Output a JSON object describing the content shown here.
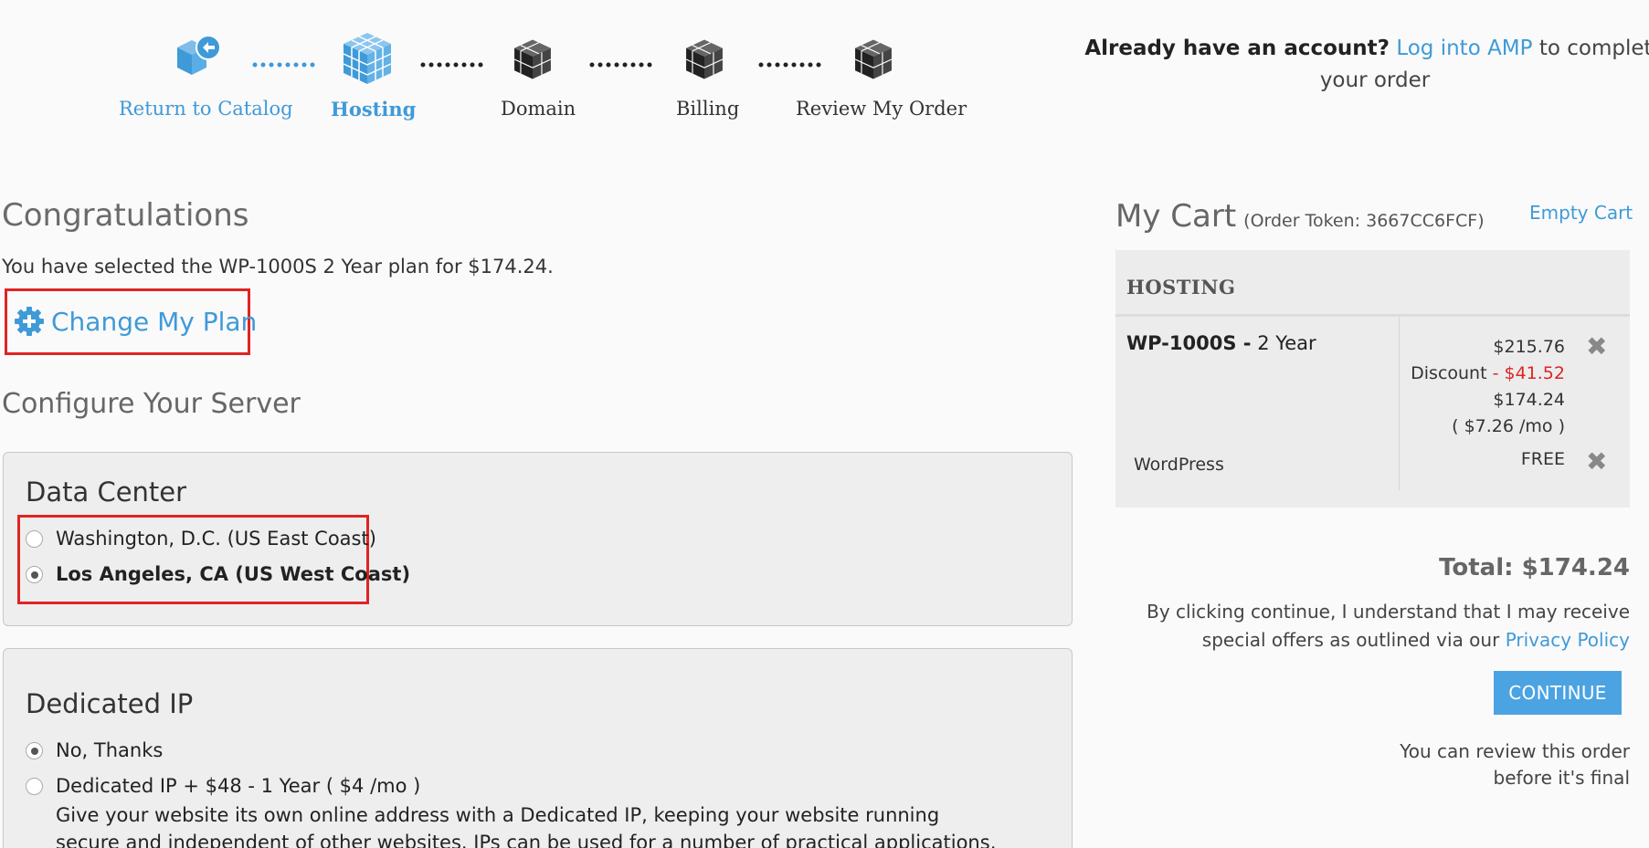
{
  "steps": [
    {
      "label": "Return to Catalog",
      "icon": "return-cube-icon",
      "state": "link"
    },
    {
      "label": "Hosting",
      "icon": "cube-icon",
      "state": "active"
    },
    {
      "label": "Domain",
      "icon": "cube-icon",
      "state": "pending"
    },
    {
      "label": "Billing",
      "icon": "cube-icon",
      "state": "pending"
    },
    {
      "label": "Review My Order",
      "icon": "cube-icon",
      "state": "pending"
    }
  ],
  "account": {
    "prompt": "Already have an account?",
    "link": "Log into AMP",
    "suffix": "to complete your order"
  },
  "main": {
    "title": "Congratulations",
    "selection_text": "You have selected the WP-1000S 2 Year plan for $174.24.",
    "change_plan_label": "Change My Plan",
    "configure_title": "Configure Your Server",
    "data_center": {
      "title": "Data Center",
      "options": [
        {
          "label": "Washington, D.C. (US East Coast)",
          "checked": false
        },
        {
          "label": "Los Angeles, CA (US West Coast)",
          "checked": true
        }
      ]
    },
    "dedicated_ip": {
      "title": "Dedicated IP",
      "options": [
        {
          "label": "No, Thanks",
          "checked": true
        },
        {
          "label": "Dedicated IP + $48 - 1 Year ( $4 /mo )",
          "checked": false
        }
      ],
      "description": "Give your website its own online address with a Dedicated IP, keeping your website running secure and independent of other websites. IPs can be used for a number of practical applications, including:"
    }
  },
  "cart": {
    "title": "My Cart",
    "token": "(Order Token: 3667CC6FCF)",
    "empty_label": "Empty Cart",
    "section": "HOSTING",
    "item": {
      "name": "WP-1000S -",
      "term": "2 Year",
      "price": "$215.76",
      "discount_label": "Discount",
      "discount_value": "- $41.52",
      "subtotal": "$174.24",
      "monthly": "( $7.26 /mo )"
    },
    "addon": {
      "name": "WordPress",
      "price": "FREE"
    },
    "total": "Total: $174.24",
    "disclaimer_prefix": "By clicking continue, I understand that I may receive special offers as outlined via our",
    "privacy_link": "Privacy Policy",
    "continue_label": "CONTINUE",
    "review_note": "You can review this order before it's final"
  },
  "colors": {
    "accent": "#3f9ad8",
    "highlight": "#e02424",
    "discount": "#e02424",
    "button": "#4ba3e2"
  }
}
